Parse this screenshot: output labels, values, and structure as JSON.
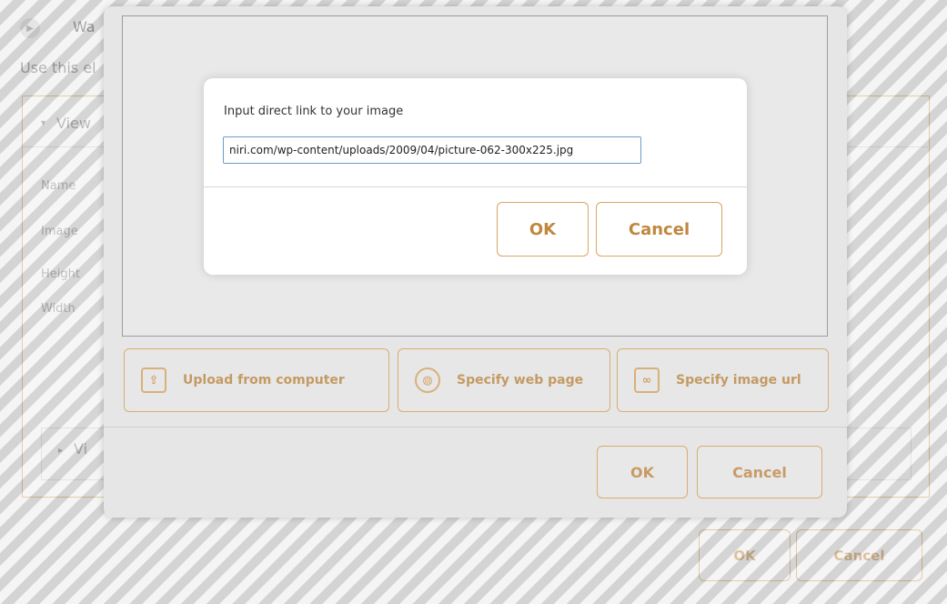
{
  "background_page": {
    "title": "Wa",
    "description": "Use this el",
    "section": {
      "label": "View"
    },
    "fields": [
      {
        "label": "Name"
      },
      {
        "label": "Image"
      },
      {
        "label": "Height"
      },
      {
        "label": "Width"
      }
    ],
    "sub_section": {
      "label": "Vi"
    },
    "buttons": {
      "ok_label": "OK",
      "cancel_label": "Cancel"
    }
  },
  "image_dialog": {
    "actions": [
      {
        "label": "Upload from computer",
        "icon": "upload-icon"
      },
      {
        "label": "Specify web page",
        "icon": "globe-icon"
      },
      {
        "label": "Specify image url",
        "icon": "link-icon"
      }
    ],
    "buttons": {
      "ok_label": "OK",
      "cancel_label": "Cancel"
    }
  },
  "url_modal": {
    "label": "Input direct link to your image",
    "input_value": "niri.com/wp-content/uploads/2009/04/picture-062-300x225.jpg",
    "buttons": {
      "ok_label": "OK",
      "cancel_label": "Cancel"
    }
  },
  "colors": {
    "accent": "#c0873f",
    "accent_border": "#d6a763",
    "input_border": "#6f9cc9"
  }
}
